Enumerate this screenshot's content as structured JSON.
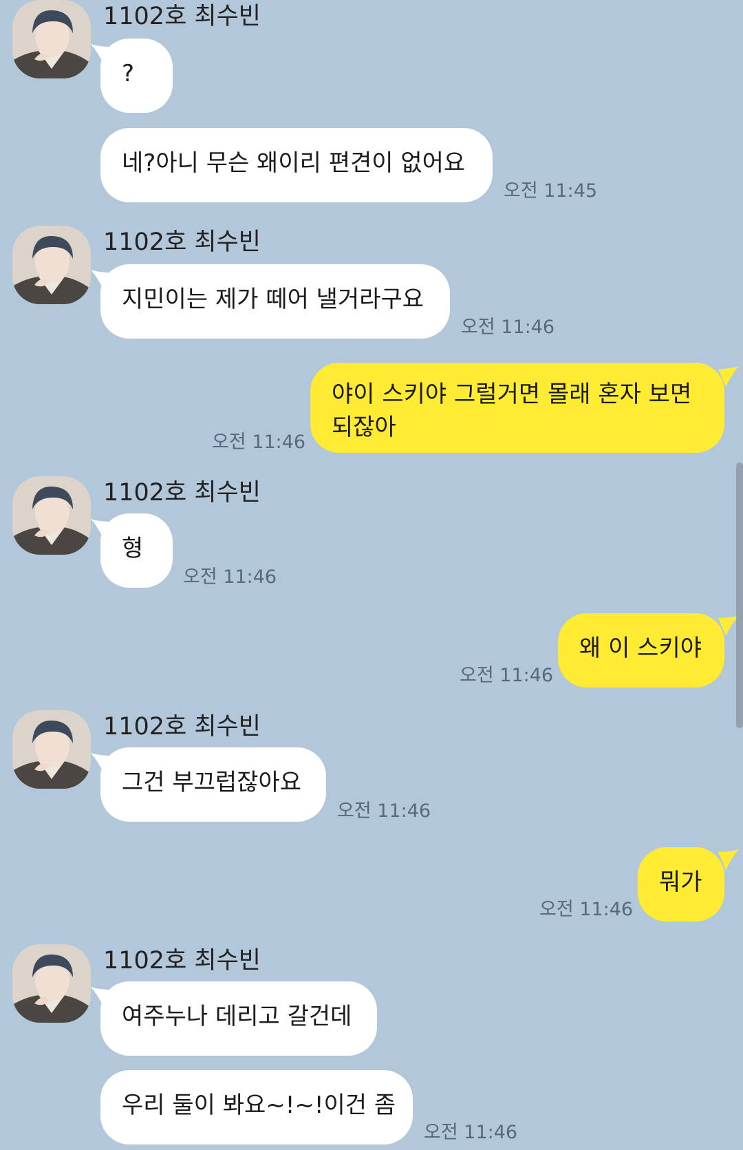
{
  "contact": {
    "name": "1102호 최수빈"
  },
  "messages": [
    {
      "sender": "1102호 최수빈",
      "text": "?",
      "time": ""
    },
    {
      "sender": "1102호 최수빈",
      "text": "네?아니 무슨 왜이리 편견이 없어요",
      "time": "오전 11:45"
    },
    {
      "sender": "1102호 최수빈",
      "text": "지민이는 제가 떼어 낼거라구요",
      "time": "오전 11:46"
    },
    {
      "sender": "me",
      "text": "야이 스키야 그럴거면 몰래 혼자 보면 되잖아",
      "time": "오전 11:46"
    },
    {
      "sender": "1102호 최수빈",
      "text": "형",
      "time": "오전 11:46"
    },
    {
      "sender": "me",
      "text": "왜 이 스키야",
      "time": "오전 11:46"
    },
    {
      "sender": "1102호 최수빈",
      "text": "그건 부끄럽잖아요",
      "time": "오전 11:46"
    },
    {
      "sender": "me",
      "text": "뭐가",
      "time": "오전 11:46"
    },
    {
      "sender": "1102호 최수빈",
      "text": "여주누나 데리고 갈건데",
      "time": ""
    },
    {
      "sender": "1102호 최수빈",
      "text": "우리 둘이 봐요~!~!이건 좀",
      "time": "오전 11:46"
    }
  ],
  "colors": {
    "background": "#b2c7da",
    "incoming_bubble": "#ffffff",
    "outgoing_bubble": "#ffeb33"
  },
  "icons": {
    "avatar": "profile-photo"
  }
}
